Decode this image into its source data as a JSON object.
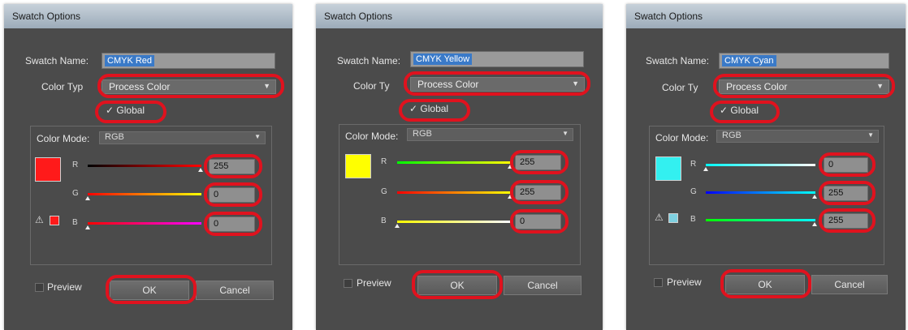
{
  "dialogs": [
    {
      "title": "Swatch Options",
      "swatch_name_label": "Swatch Name:",
      "swatch_name_value": "CMYK Red",
      "color_type_label": "Color Typ",
      "color_type_value": "Process Color",
      "global_label": "Global",
      "color_mode_label": "Color Mode:",
      "color_mode_value": "RGB",
      "channels": [
        {
          "label": "R",
          "value": "255"
        },
        {
          "label": "G",
          "value": "0"
        },
        {
          "label": "B",
          "value": "0"
        }
      ],
      "swatch_color": "#ff1a1a",
      "preview_label": "Preview",
      "ok_label": "OK",
      "cancel_label": "Cancel"
    },
    {
      "title": "Swatch Options",
      "swatch_name_label": "Swatch Name:",
      "swatch_name_value": "CMYK Yellow",
      "color_type_label": "Color Ty",
      "color_type_value": "Process Color",
      "global_label": "Global",
      "color_mode_label": "Color Mode:",
      "color_mode_value": "RGB",
      "channels": [
        {
          "label": "R",
          "value": "255"
        },
        {
          "label": "G",
          "value": "255"
        },
        {
          "label": "B",
          "value": "0"
        }
      ],
      "swatch_color": "#ffff00",
      "preview_label": "Preview",
      "ok_label": "OK",
      "cancel_label": "Cancel"
    },
    {
      "title": "Swatch Options",
      "swatch_name_label": "Swatch Name:",
      "swatch_name_value": "CMYK Cyan",
      "color_type_label": "Color Ty",
      "color_type_value": "Process Color",
      "global_label": "Global",
      "color_mode_label": "Color Mode:",
      "color_mode_value": "RGB",
      "channels": [
        {
          "label": "R",
          "value": "0"
        },
        {
          "label": "G",
          "value": "255"
        },
        {
          "label": "B",
          "value": "255"
        }
      ],
      "swatch_color": "#33f0f0",
      "preview_label": "Preview",
      "ok_label": "OK",
      "cancel_label": "Cancel"
    }
  ],
  "highlight_color": "#e0121e",
  "icons": {
    "check": "checkmark-icon",
    "caret": "chevron-down-icon",
    "warning": "warning-triangle-icon"
  }
}
